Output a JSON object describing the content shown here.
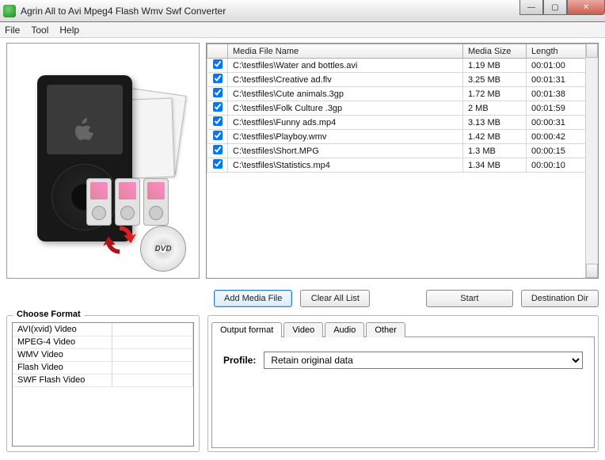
{
  "title": "Agrin All to Avi Mpeg4 Flash Wmv Swf Converter",
  "menu": {
    "file": "File",
    "tool": "Tool",
    "help": "Help"
  },
  "dvd_label": "DVD",
  "table": {
    "headers": {
      "name": "Media File Name",
      "size": "Media Size",
      "length": "Length"
    },
    "rows": [
      {
        "checked": true,
        "name": "C:\\testfiles\\Water and bottles.avi",
        "size": "1.19 MB",
        "length": "00:01:00"
      },
      {
        "checked": true,
        "name": "C:\\testfiles\\Creative ad.flv",
        "size": "3.25 MB",
        "length": "00:01:31"
      },
      {
        "checked": true,
        "name": "C:\\testfiles\\Cute animals.3gp",
        "size": "1.72 MB",
        "length": "00:01:38"
      },
      {
        "checked": true,
        "name": "C:\\testfiles\\Folk Culture .3gp",
        "size": "2 MB",
        "length": "00:01:59"
      },
      {
        "checked": true,
        "name": "C:\\testfiles\\Funny ads.mp4",
        "size": "3.13 MB",
        "length": "00:00:31"
      },
      {
        "checked": true,
        "name": "C:\\testfiles\\Playboy.wmv",
        "size": "1.42 MB",
        "length": "00:00:42"
      },
      {
        "checked": true,
        "name": "C:\\testfiles\\Short.MPG",
        "size": "1.3 MB",
        "length": "00:00:15"
      },
      {
        "checked": true,
        "name": "C:\\testfiles\\Statistics.mp4",
        "size": "1.34 MB",
        "length": "00:00:10"
      }
    ]
  },
  "buttons": {
    "add": "Add Media File",
    "clear": "Clear All List",
    "start": "Start",
    "dest": "Destination Dir"
  },
  "format": {
    "legend": "Choose Format",
    "items": [
      "AVI(xvid) Video",
      "MPEG-4 Video",
      "WMV Video",
      "Flash Video",
      "SWF Flash Video"
    ]
  },
  "tabs": {
    "output": "Output format",
    "video": "Video",
    "audio": "Audio",
    "other": "Other"
  },
  "profile": {
    "label": "Profile:",
    "value": "Retain original data"
  }
}
